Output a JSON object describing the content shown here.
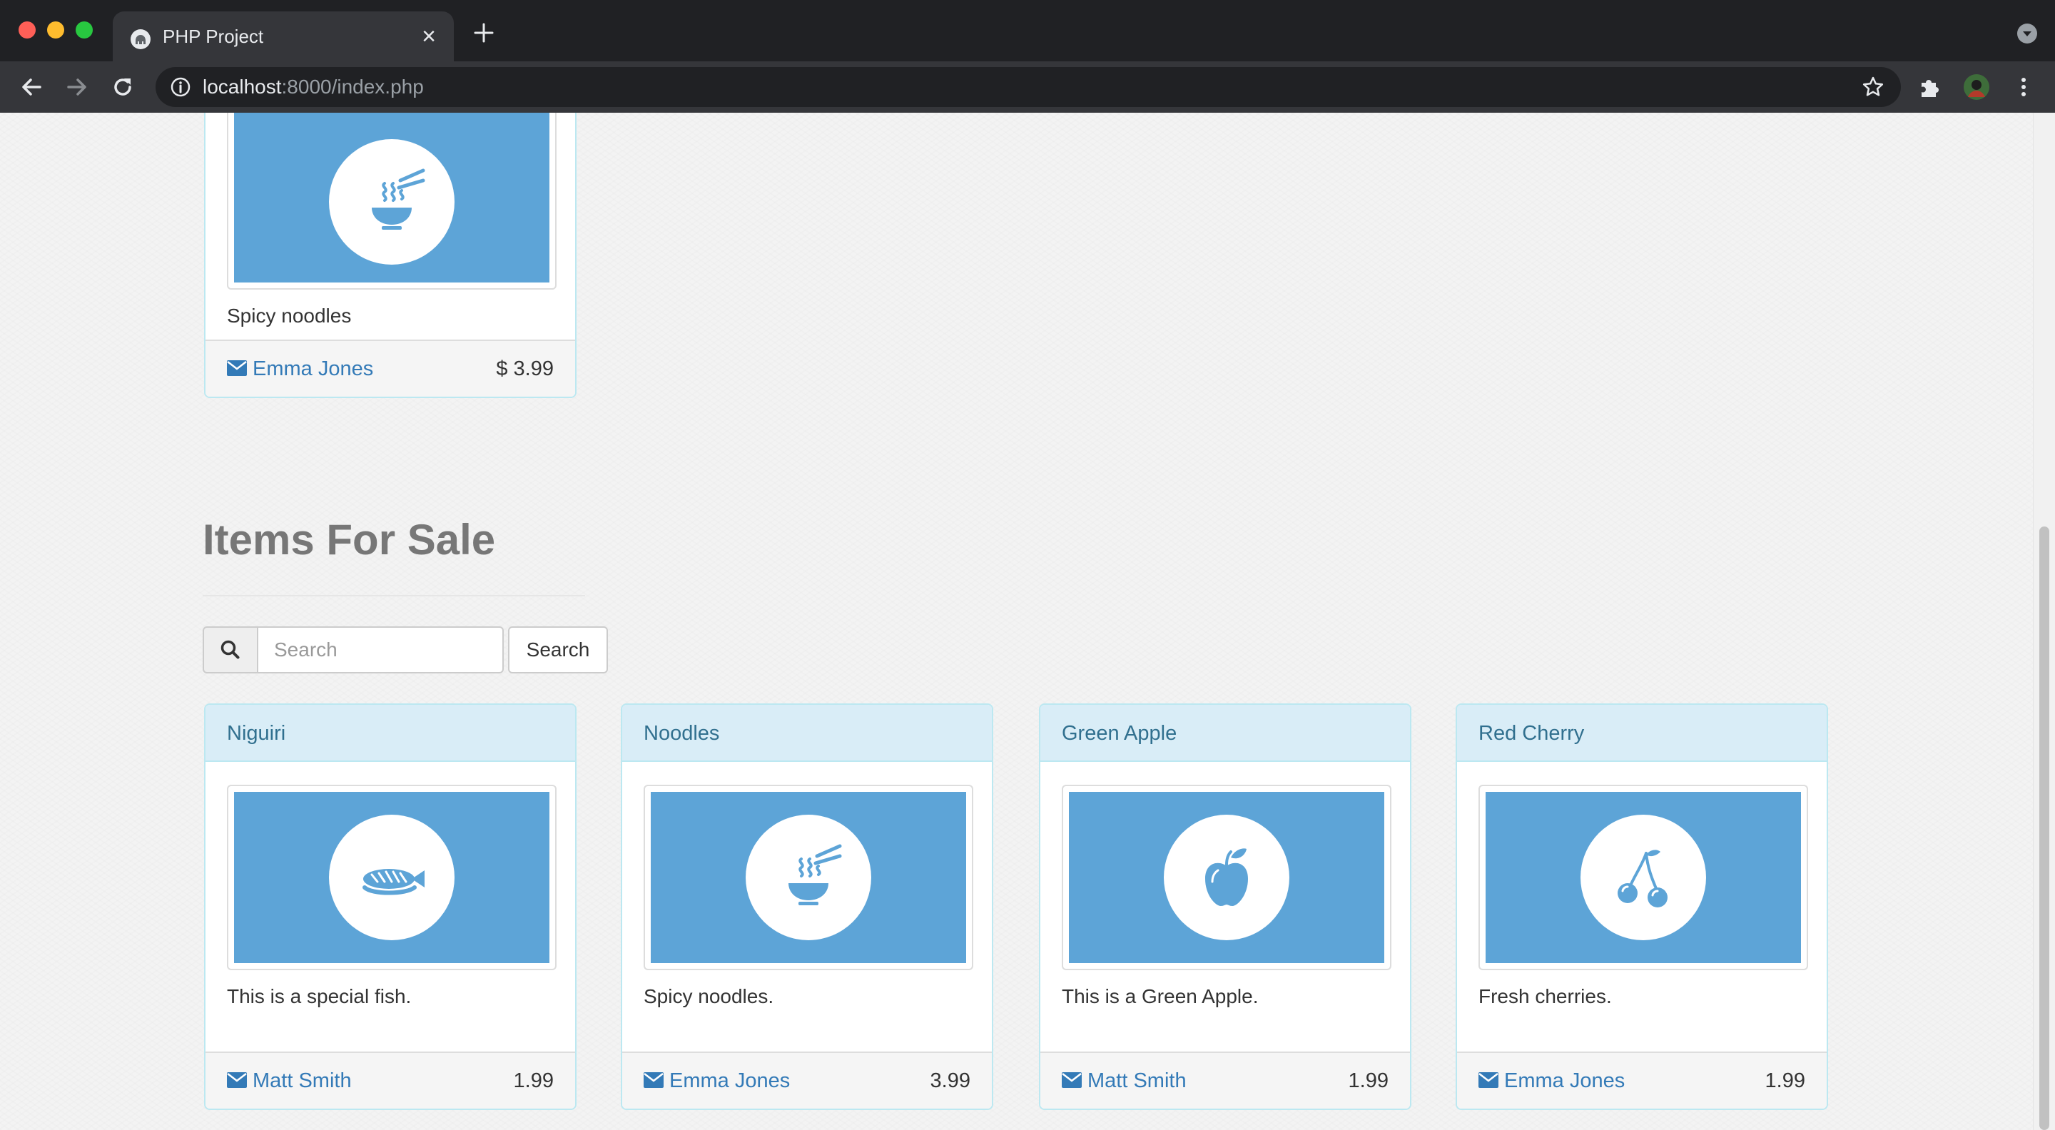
{
  "browser": {
    "tab_title": "PHP Project",
    "url_host": "localhost",
    "url_rest": ":8000/index.php"
  },
  "page": {
    "top_panel": {
      "description": "Spicy noodles",
      "seller": "Emma Jones",
      "price": "$ 3.99",
      "icon": "noodle-bowl-icon"
    },
    "section_title": "Items For Sale",
    "search": {
      "placeholder": "Search",
      "button_label": "Search"
    },
    "items": [
      {
        "title": "Niguiri",
        "description": "This is a special fish.",
        "seller": "Matt Smith",
        "price": "1.99",
        "icon": "fish-icon"
      },
      {
        "title": "Noodles",
        "description": "Spicy noodles.",
        "seller": "Emma Jones",
        "price": "3.99",
        "icon": "noodle-bowl-icon"
      },
      {
        "title": "Green Apple",
        "description": "This is a Green Apple.",
        "seller": "Matt Smith",
        "price": "1.99",
        "icon": "apple-icon"
      },
      {
        "title": "Red Cherry",
        "description": "Fresh cherries.",
        "seller": "Emma Jones",
        "price": "1.99",
        "icon": "cherry-icon"
      }
    ]
  },
  "colors": {
    "panel_heading_bg": "#d9edf7",
    "panel_border": "#bce8f1",
    "heading_text": "#31708f",
    "link": "#337ab7",
    "image_bg": "#5da4d7"
  }
}
